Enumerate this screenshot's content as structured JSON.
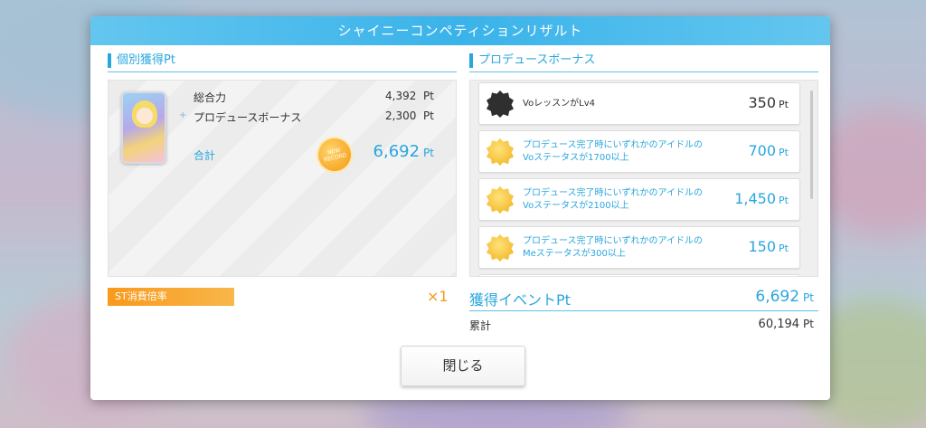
{
  "dialog": {
    "title": "シャイニーコンペティションリザルト",
    "close_label": "閉じる"
  },
  "individual": {
    "section_title": "個別獲得Pt",
    "stats": [
      {
        "label": "総合力",
        "value": "4,392",
        "unit": "Pt"
      },
      {
        "label": "プロデュースボーナス",
        "value": "2,300",
        "unit": "Pt"
      }
    ],
    "total_label": "合計",
    "total_value": "6,692",
    "total_unit": "Pt",
    "badge_line1": "NEW",
    "badge_line2": "RECORD"
  },
  "produce_bonus": {
    "section_title": "プロデュースボーナス",
    "items": [
      {
        "icon": "dark-star-icon",
        "line1": "VoレッスンがLv4",
        "line2": "",
        "points": "350",
        "unit": "Pt",
        "style": "dark"
      },
      {
        "icon": "gold-star-icon",
        "line1": "プロデュース完了時にいずれかのアイドルの",
        "line2": "Voステータスが1700以上",
        "points": "700",
        "unit": "Pt",
        "style": "blue"
      },
      {
        "icon": "gold-star-icon",
        "line1": "プロデュース完了時にいずれかのアイドルの",
        "line2": "Voステータスが2100以上",
        "points": "1,450",
        "unit": "Pt",
        "style": "blue"
      },
      {
        "icon": "gold-star-icon",
        "line1": "プロデュース完了時にいずれかのアイドルの",
        "line2": "Meステータスが300以上",
        "points": "150",
        "unit": "Pt",
        "style": "blue"
      }
    ]
  },
  "st_rate": {
    "label": "ST消費倍率",
    "value": "×1"
  },
  "event": {
    "label": "獲得イベントPt",
    "value": "6,692",
    "unit": "Pt"
  },
  "cumulative": {
    "label": "累計",
    "value": "60,194",
    "unit": "Pt"
  },
  "colors": {
    "accent": "#2aa6de",
    "orange": "#f79a1c",
    "header": "#3ab3ea"
  }
}
